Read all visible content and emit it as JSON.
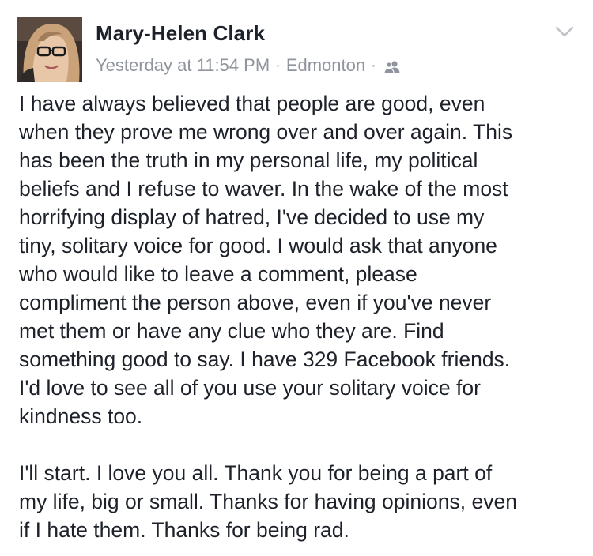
{
  "post": {
    "author_name": "Mary-Helen Clark",
    "timestamp": "Yesterday at 11:54 PM",
    "separator": "·",
    "location": "Edmonton",
    "audience_icon": "friends-icon",
    "menu_icon": "chevron-down-icon",
    "paragraphs": [
      "I have always believed that people are good, even\nwhen they prove me wrong over and over again. This\nhas been the truth in my personal life, my political\nbeliefs and I refuse to waver. In the wake of the most\nhorrifying display of hatred, I've decided to use my\ntiny, solitary voice for good. I would ask that anyone\nwho would like to leave a comment, please\ncompliment the person above, even if you've never\nmet them or have any clue who they are. Find\nsomething good to say. I have 329 Facebook friends.\nI'd love to see all of you use your solitary voice for\nkindness too.",
      "I'll start. I love you all. Thank you for being a part of\nmy life, big or small. Thanks for having opinions, even\nif I hate them. Thanks for being rad."
    ]
  },
  "colors": {
    "text": "#1d2129",
    "meta": "#90949c",
    "chevron": "#bec2c9"
  }
}
